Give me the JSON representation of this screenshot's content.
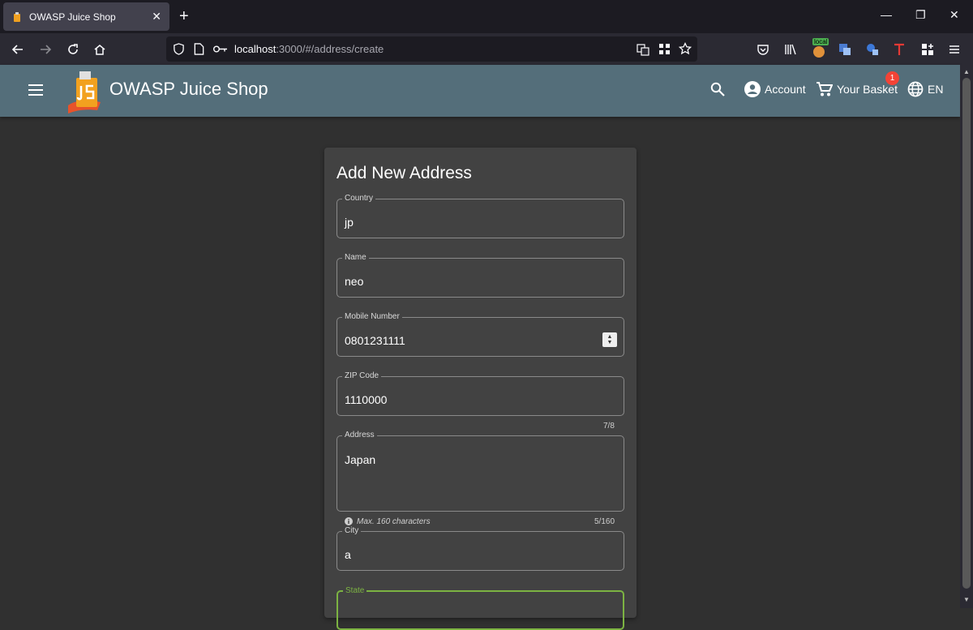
{
  "browser": {
    "tab_title": "OWASP Juice Shop",
    "url_host": "localhost",
    "url_rest": ":3000/#/address/create",
    "ext_badge": "local"
  },
  "app": {
    "title": "OWASP Juice Shop",
    "account_label": "Account",
    "basket_label": "Your Basket",
    "basket_count": "1",
    "language": "EN"
  },
  "form": {
    "title": "Add New Address",
    "fields": {
      "country": {
        "label": "Country",
        "value": "jp"
      },
      "name": {
        "label": "Name",
        "value": "neo"
      },
      "mobile": {
        "label": "Mobile Number",
        "value": "0801231111"
      },
      "zip": {
        "label": "ZIP Code",
        "value": "1110000",
        "counter": "7/8"
      },
      "address": {
        "label": "Address",
        "value": "Japan",
        "hint": "Max. 160 characters",
        "counter": "5/160"
      },
      "city": {
        "label": "City",
        "value": "a"
      },
      "state": {
        "label": "State",
        "value": ""
      }
    }
  }
}
